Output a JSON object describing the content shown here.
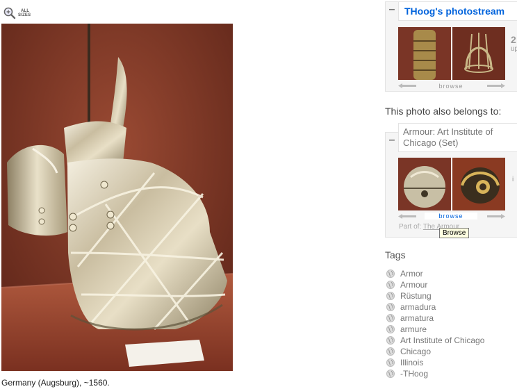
{
  "zoom": {
    "label_line1": "ALL",
    "label_line2": "SIZES"
  },
  "photo": {
    "caption": "Germany (Augsburg), ~1560."
  },
  "photostream": {
    "title": "THoog's photostream",
    "browse_label": "browse",
    "side_fragment_1": "2",
    "side_fragment_2": "up"
  },
  "also_belongs": {
    "heading": "This photo also belongs to:"
  },
  "set": {
    "title": "Armour: Art Institute of Chicago (Set)",
    "browse_label": "browse",
    "part_of_label": "Part of:",
    "part_of_link": "The Armour",
    "side_fragment": "i"
  },
  "tooltip": {
    "text": "Browse"
  },
  "tags": {
    "heading": "Tags",
    "items": [
      "Armor",
      "Armour",
      "Rüstung",
      "armadura",
      "armatura",
      "armure",
      "Art Institute of Chicago",
      "Chicago",
      "Illinois",
      "-THoog"
    ]
  },
  "colors": {
    "link_blue": "#0063dc",
    "backdrop_red": "#7a3526"
  },
  "icons": {
    "zoom": "magnifier-plus-icon",
    "tag": "globe-icon",
    "prev": "left-arrow-icon",
    "next": "right-arrow-icon"
  }
}
